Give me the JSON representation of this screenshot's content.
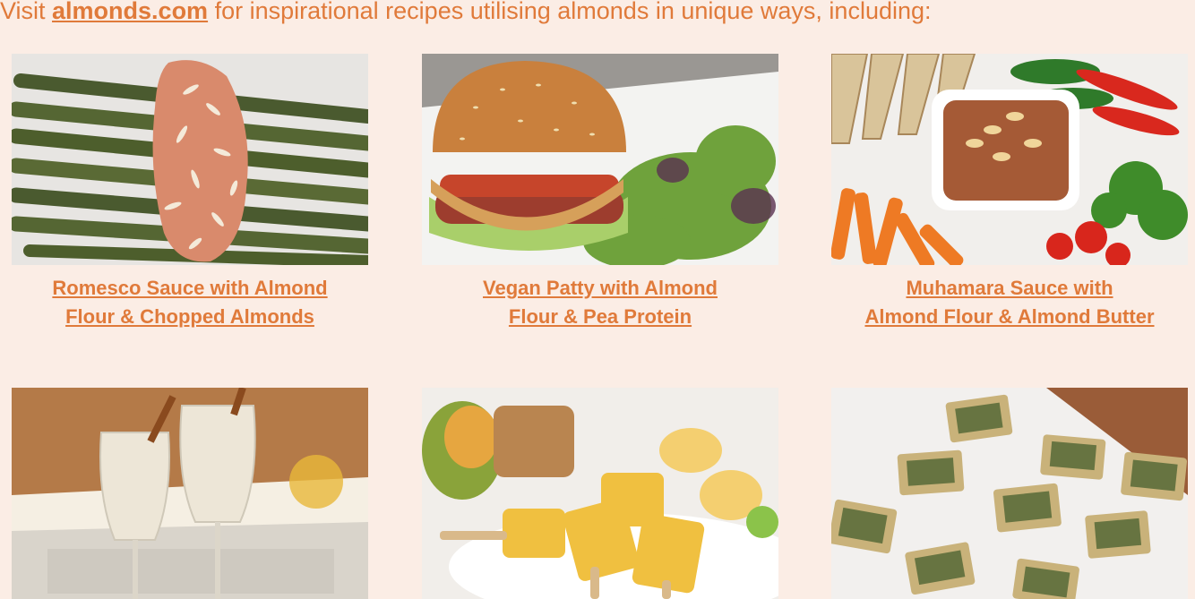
{
  "intro": {
    "prefix": "Visit ",
    "link": "almonds.com",
    "suffix": " for inspirational recipes utilising almonds in unique ways, including:"
  },
  "recipes": [
    {
      "line1": "Romesco Sauce with Almond ",
      "line2": "Flour & Chopped Almonds "
    },
    {
      "line1": "Vegan Patty with Almond ",
      "line2": "Flour & Pea Protein"
    },
    {
      "line1": "Muhamara Sauce with ",
      "line2": "Almond Flour & Almond Butter"
    }
  ],
  "colors": {
    "background": "#fbede5",
    "accent": "#e07a3a"
  }
}
